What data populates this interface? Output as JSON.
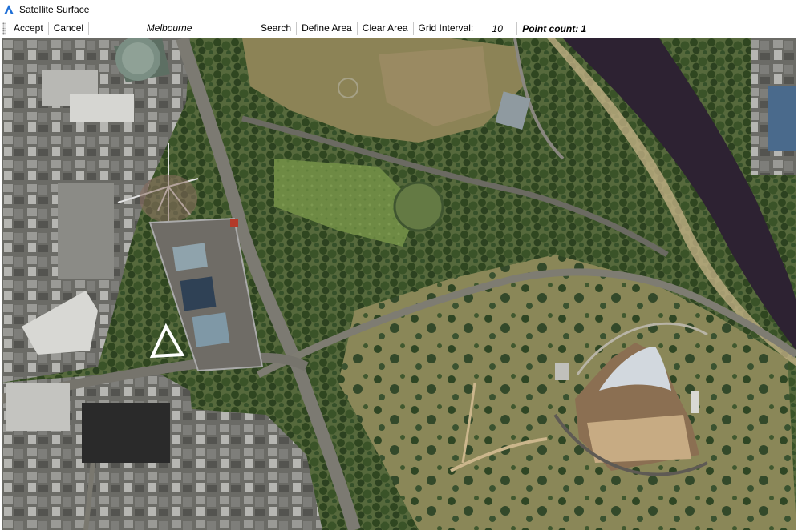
{
  "window": {
    "title": "Satellite Surface",
    "icon": "app-logo-icon"
  },
  "toolbar": {
    "accept_label": "Accept",
    "cancel_label": "Cancel",
    "location_value": "Melbourne",
    "search_label": "Search",
    "define_area_label": "Define Area",
    "clear_area_label": "Clear Area",
    "grid_interval_label": "Grid Interval:",
    "grid_interval_value": "10",
    "point_count_text": "Point count: 1"
  },
  "map": {
    "type": "satellite-imagery"
  }
}
